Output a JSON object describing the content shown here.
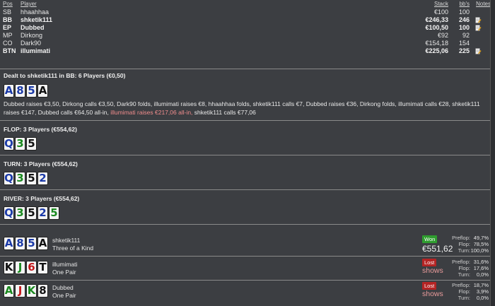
{
  "headers": {
    "pos": "Pos",
    "player": "Player",
    "stack": "Stack",
    "bb": "bb's",
    "notes": "Notes"
  },
  "players": [
    {
      "pos": "SB",
      "name": "hhaahhaa",
      "stack": "€100",
      "bb": "100",
      "bold": false
    },
    {
      "pos": "BB",
      "name": "shketik111",
      "stack": "€246,33",
      "bb": "246",
      "bold": true
    },
    {
      "pos": "EP",
      "name": "Dubbed",
      "stack": "€100,50",
      "bb": "100",
      "bold": true
    },
    {
      "pos": "MP",
      "name": "Dirkong",
      "stack": "€92",
      "bb": "92",
      "bold": false
    },
    {
      "pos": "CO",
      "name": "Dark90",
      "stack": "€154,18",
      "bb": "154",
      "bold": false
    },
    {
      "pos": "BTN",
      "name": "illumimati",
      "stack": "€225,06",
      "bb": "225",
      "bold": true
    }
  ],
  "preflop": {
    "title": "Dealt to shketik111 in BB: 6 Players (€0,50)",
    "cards": [
      {
        "r": "A",
        "s": "blue"
      },
      {
        "r": "8",
        "s": "blue"
      },
      {
        "r": "5",
        "s": "blue"
      },
      {
        "r": "A",
        "s": "black"
      }
    ],
    "actions_line1": "Dubbed raises €3,50, Dirkong calls €3,50, Dark90 folds, illumimati raises €8, hhaahhaa folds, shketik111 calls €7, Dubbed raises €36, Dirkong folds, illumimati calls €28, shketik111",
    "actions_line2a": "raises €147, Dubbed calls €64,50 all-in, ",
    "actions_line2b": "illumimati raises €217,06 all-in,",
    "actions_line2c": " shketik111 calls €77,06"
  },
  "flop": {
    "title": "FLOP: 3 Players (€554,62)",
    "cards": [
      {
        "r": "Q",
        "s": "blue"
      },
      {
        "r": "3",
        "s": "green"
      },
      {
        "r": "5",
        "s": "black"
      }
    ]
  },
  "turn": {
    "title": "TURN: 3 Players (€554,62)",
    "cards": [
      {
        "r": "Q",
        "s": "blue"
      },
      {
        "r": "3",
        "s": "green"
      },
      {
        "r": "5",
        "s": "black"
      },
      {
        "r": "2",
        "s": "blue"
      }
    ]
  },
  "river": {
    "title": "RIVER: 3 Players (€554,62)",
    "cards": [
      {
        "r": "Q",
        "s": "blue"
      },
      {
        "r": "3",
        "s": "green"
      },
      {
        "r": "5",
        "s": "black"
      },
      {
        "r": "2",
        "s": "blue"
      },
      {
        "r": "5",
        "s": "green"
      }
    ]
  },
  "results": [
    {
      "name": "shketik111",
      "hand": "Three of a Kind",
      "cards": [
        {
          "r": "A",
          "s": "blue"
        },
        {
          "r": "8",
          "s": "blue"
        },
        {
          "r": "5",
          "s": "blue"
        },
        {
          "r": "A",
          "s": "black"
        }
      ],
      "badge": "Won",
      "amount": "€551,62",
      "shows": "",
      "stats": [
        {
          "k": "Preflop:",
          "v": "49,7%"
        },
        {
          "k": "Flop:",
          "v": "78,5%"
        },
        {
          "k": "Turn:",
          "v": "100,0%"
        }
      ]
    },
    {
      "name": "illumimati",
      "hand": "One Pair",
      "cards": [
        {
          "r": "K",
          "s": "black"
        },
        {
          "r": "J",
          "s": "green"
        },
        {
          "r": "6",
          "s": "red"
        },
        {
          "r": "T",
          "s": "black"
        }
      ],
      "badge": "Lost",
      "amount": "",
      "shows": "shows",
      "stats": [
        {
          "k": "Preflop:",
          "v": "31,6%"
        },
        {
          "k": "Flop:",
          "v": "17,6%"
        },
        {
          "k": "Turn:",
          "v": "0,0%"
        }
      ]
    },
    {
      "name": "Dubbed",
      "hand": "One Pair",
      "cards": [
        {
          "r": "A",
          "s": "green"
        },
        {
          "r": "J",
          "s": "red"
        },
        {
          "r": "K",
          "s": "green"
        },
        {
          "r": "8",
          "s": "black"
        }
      ],
      "badge": "Lost",
      "amount": "",
      "shows": "shows",
      "stats": [
        {
          "k": "Preflop:",
          "v": "18,7%"
        },
        {
          "k": "Flop:",
          "v": "3,9%"
        },
        {
          "k": "Turn:",
          "v": "0,0%"
        }
      ]
    }
  ]
}
